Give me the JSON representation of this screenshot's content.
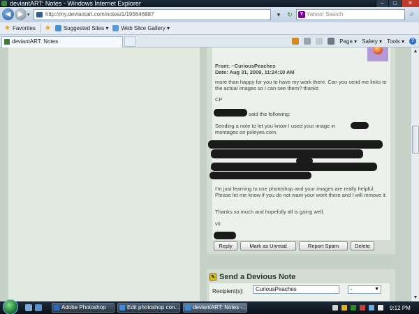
{
  "window": {
    "title": "deviantART: Notes - Windows Internet Explorer"
  },
  "addressbar": {
    "url": "http://my.deviantart.com/notes/1/195646887",
    "search_placeholder": "Yahoo! Search"
  },
  "favorites": {
    "favorites_label": "Favorites",
    "suggested_sites": "Suggested Sites ▾",
    "web_slice_gallery": "Web Slice Gallery ▾"
  },
  "tab": {
    "title": "deviantART: Notes"
  },
  "commandbar": {
    "page": "Page ▾",
    "safety": "Safety ▾",
    "tools": "Tools ▾"
  },
  "note": {
    "from": "From: ~CuriousPeaches",
    "date": "Date: Aug 31, 2009, 11:24:10 AM",
    "reply_text": "more than happy for you to have my work there. Can you send me links to the actual images so I can see them? thanks",
    "signature": "CP",
    "quoted_said": "said the following:",
    "quoted_intro": "Sending a note to let you know I used your image in",
    "quoted_intro_2": "montages on pxleyes.com.",
    "quoted_learning": "I'm just learning to use photoshop and your images are really helpful. Please let me know if you do not want your work there and I will remove it.",
    "quoted_thanks": "Thanks so much and hopefully all is going well.",
    "quoted_closing": "v/r"
  },
  "actions": {
    "reply": "Reply",
    "mark_unread": "Mark as Unread",
    "report_spam": "Report Spam",
    "delete": "Delete"
  },
  "send_note": {
    "title": "Send a Devious Note",
    "recipient_label": "Recipient(s):",
    "recipient_value": "CuriousPeaches",
    "select_value": "-"
  },
  "taskbar": {
    "items": [
      "Adobe Photoshop",
      "Edit photoshop con...",
      "deviantART: Notes -..."
    ],
    "clock": "9:12 PM"
  },
  "colors": {
    "page_bg": "#c6d2c6",
    "note_bg": "#ecf1eb",
    "text": "#3a4a3a"
  }
}
